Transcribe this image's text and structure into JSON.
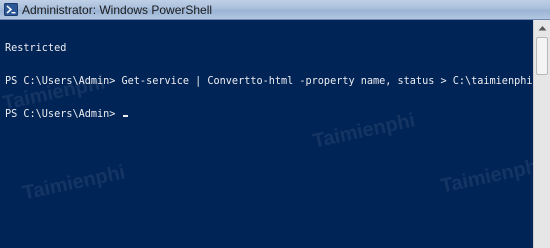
{
  "window": {
    "title": "Administrator: Windows PowerShell"
  },
  "console": {
    "lines": [
      "Restricted",
      "PS C:\\Users\\Admin> Get-service | Convertto-html -property name, status > C:\\taimienphi.html",
      "PS C:\\Users\\Admin> "
    ]
  },
  "watermark": {
    "text": "Taimienphi"
  },
  "icons": {
    "title": "powershell-icon",
    "scroll_up": "chevron-up-icon"
  },
  "colors": {
    "console_background": "#012456",
    "console_text": "#eeedf0"
  }
}
